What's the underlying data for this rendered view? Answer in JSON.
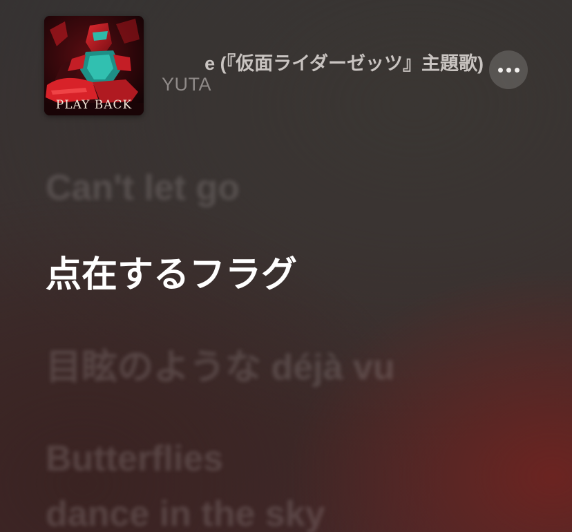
{
  "now_playing": {
    "title": "e (『仮面ライダーゼッツ』主題歌)",
    "artist": "YUTA",
    "artwork": {
      "text": "PLAY BACK",
      "icon": "album-artwork"
    },
    "more_icon": "ellipsis-icon"
  },
  "lyrics": [
    {
      "text": "Can't let go",
      "state": "past"
    },
    {
      "text": "点在するフラグ",
      "state": "current"
    },
    {
      "text": "目眩のような déjà vu",
      "state": "upcoming"
    },
    {
      "text": "Butterflies",
      "state": "upcoming"
    },
    {
      "text": "dance in the sky",
      "state": "upcoming"
    }
  ],
  "colors": {
    "current_lyric": "#ffffff",
    "accent_red": "#c41e26",
    "accent_teal": "#2fb8a8"
  }
}
